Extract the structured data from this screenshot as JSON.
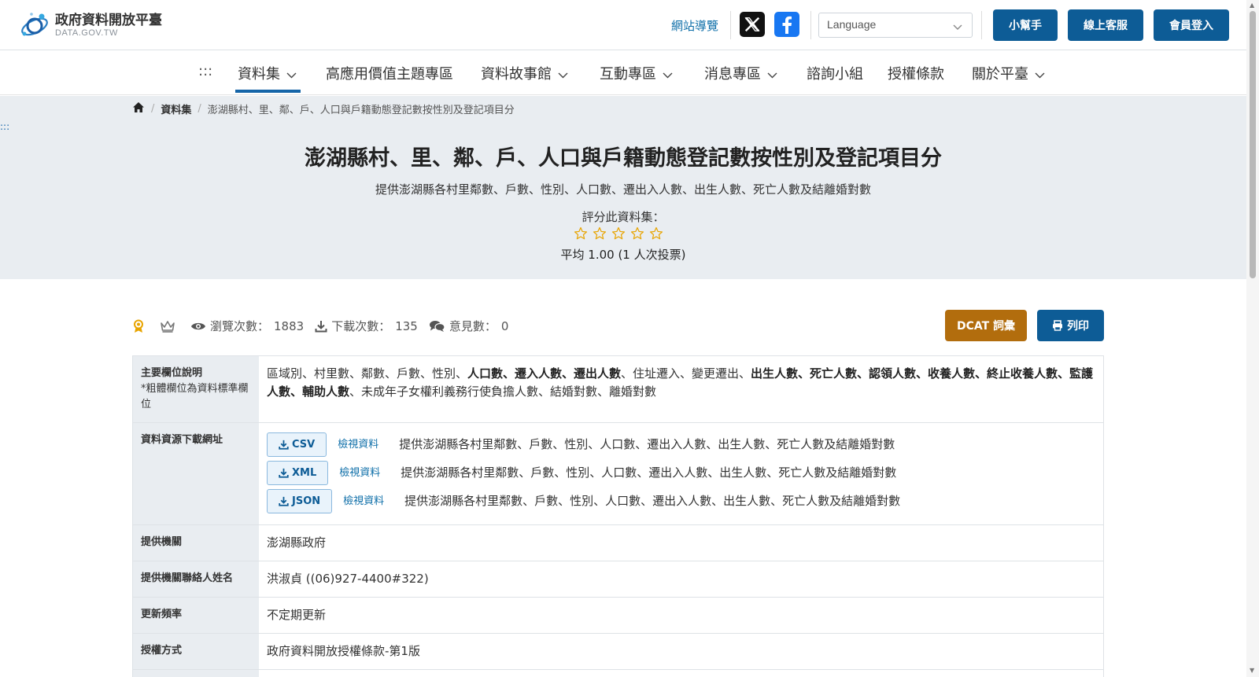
{
  "header": {
    "logo_title": "政府資料開放平臺",
    "logo_sub": "DATA.GOV.TW",
    "site_nav": "網站導覽",
    "language_placeholder": "Language",
    "buttons": [
      "小幫手",
      "線上客服",
      "會員登入"
    ]
  },
  "nav": {
    "accesskey": ":::",
    "items": [
      "資料集",
      "高應用價值主題專區",
      "資料故事館",
      "互動專區",
      "消息專區",
      "諮詢小組",
      "授權條款",
      "關於平臺"
    ]
  },
  "breadcrumb": {
    "level1": "資料集",
    "current": "澎湖縣村、里、鄰、戶、人口與戶籍動態登記數按性別及登記項目分"
  },
  "hero": {
    "accesskey": ":::",
    "title": "澎湖縣村、里、鄰、戶、人口與戶籍動態登記數按性別及登記項目分",
    "subtitle": "提供澎湖縣各村里鄰數、戶數、性別、人口數、遷出入人數、出生人數、死亡人數及結離婚對數",
    "rate_label": "評分此資料集：",
    "stars_total": 5,
    "average_text": "平均 1.00 (1 人次投票)"
  },
  "stats": {
    "views_label": "瀏覽次數：",
    "views": "1883",
    "downloads_label": "下載次數：",
    "downloads": "135",
    "comments_label": "意見數：",
    "comments": "0"
  },
  "actions": {
    "dcat": "DCAT 詞彙",
    "print": "列印"
  },
  "info": {
    "fields_key": "主要欄位說明",
    "fields_note": "*粗體欄位為資料標準欄位",
    "fields_value": [
      {
        "t": "區域別、村里數、鄰數、戶數、性別、",
        "b": false
      },
      {
        "t": "人口數、遷入人數、遷出人數",
        "b": true
      },
      {
        "t": "、住址遷入、變更遷出、",
        "b": false
      },
      {
        "t": "出生人數、死亡人數、認領人數、收養人數、終止收養人數、監護人數、輔助人數",
        "b": true
      },
      {
        "t": "、未成年子女權利義務行使負擔人數、結婚對數、離婚對數",
        "b": false
      }
    ],
    "resources_key": "資料資源下載網址",
    "resources": [
      {
        "format": "CSV",
        "view": "檢視資料",
        "desc": "提供澎湖縣各村里鄰數、戶數、性別、人口數、遷出入人數、出生人數、死亡人數及結離婚對數"
      },
      {
        "format": "XML",
        "view": "檢視資料",
        "desc": "提供澎湖縣各村里鄰數、戶數、性別、人口數、遷出入人數、出生人數、死亡人數及結離婚對數"
      },
      {
        "format": "JSON",
        "view": "檢視資料",
        "desc": "提供澎湖縣各村里鄰數、戶數、性別、人口數、遷出入人數、出生人數、死亡人數及結離婚對數"
      }
    ],
    "agency_key": "提供機關",
    "agency_value": "澎湖縣政府",
    "contact_key": "提供機關聯絡人姓名",
    "contact_value": "洪淑貞 ((06)927-4400#322)",
    "frequency_key": "更新頻率",
    "frequency_value": "不定期更新",
    "license_key": "授權方式",
    "license_value": "政府資料開放授權條款-第1版"
  },
  "colors": {
    "primary": "#0d5c96",
    "dcat": "#b26d0d",
    "hero_bg": "#e9edf1",
    "star": "#e8a400",
    "link": "#0d6ea8"
  }
}
